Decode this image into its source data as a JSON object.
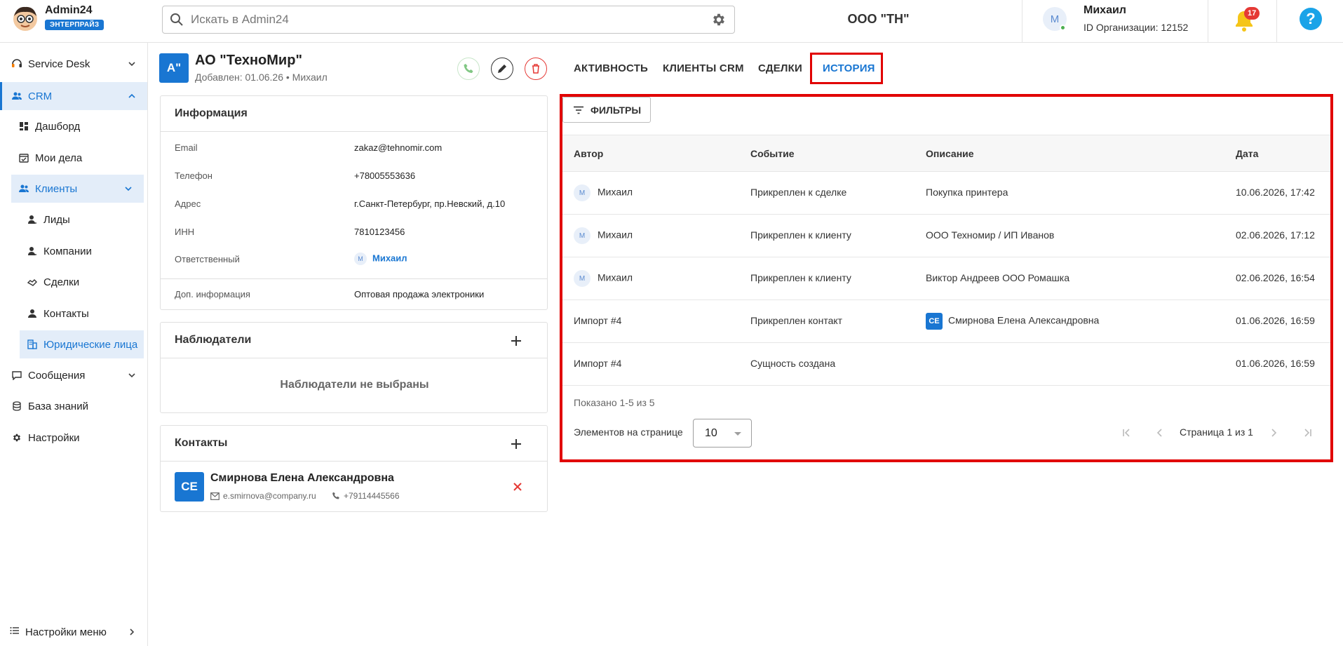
{
  "brand": {
    "name": "Admin24",
    "badge": "ЭНТЕРПРАЙЗ"
  },
  "search": {
    "placeholder": "Искать в Admin24"
  },
  "org": {
    "name": "ООО \"ТН\""
  },
  "user": {
    "avatar_letter": "М",
    "name": "Михаил",
    "org_id": "ID Организации: 12152"
  },
  "notifications": {
    "count": "17"
  },
  "help": {
    "label": "?"
  },
  "sidebar": {
    "items": [
      {
        "label": "Service Desk"
      },
      {
        "label": "CRM"
      },
      {
        "label": "Дашборд"
      },
      {
        "label": "Мои дела"
      },
      {
        "label": "Клиенты"
      },
      {
        "label": "Лиды"
      },
      {
        "label": "Компании"
      },
      {
        "label": "Сделки"
      },
      {
        "label": "Контакты"
      },
      {
        "label": "Юридические лица"
      },
      {
        "label": "Сообщения"
      },
      {
        "label": "База знаний"
      },
      {
        "label": "Настройки"
      }
    ],
    "footer": "Настройки меню"
  },
  "entity": {
    "avatar": "А\"",
    "title": "АО \"ТехноМир\"",
    "subtitle": "Добавлен: 01.06.26 • Михаил"
  },
  "info_card": {
    "title": "Информация",
    "rows": [
      {
        "key": "Email",
        "value": "zakaz@tehnomir.com"
      },
      {
        "key": "Телефон",
        "value": "+78005553636"
      },
      {
        "key": "Адрес",
        "value": "г.Санкт-Петербург, пр.Невский, д.10"
      },
      {
        "key": "ИНН",
        "value": "7810123456"
      },
      {
        "key": "Ответственный",
        "value": "Михаил",
        "avatar": "М"
      },
      {
        "key": "Доп. информация",
        "value": "Оптовая продажа электроники"
      }
    ]
  },
  "watchers_card": {
    "title": "Наблюдатели",
    "empty": "Наблюдатели не выбраны"
  },
  "contacts_card": {
    "title": "Контакты",
    "contact": {
      "initials": "СЕ",
      "name": "Смирнова Елена Александровна",
      "email": "e.smirnova@company.ru",
      "phone": "+79114445566"
    }
  },
  "tabs": [
    {
      "label": "АКТИВНОСТЬ"
    },
    {
      "label": "КЛИЕНТЫ CRM"
    },
    {
      "label": "СДЕЛКИ"
    },
    {
      "label": "ИСТОРИЯ"
    }
  ],
  "history": {
    "filter_label": "ФИЛЬТРЫ",
    "columns": [
      "Автор",
      "Событие",
      "Описание",
      "Дата"
    ],
    "rows": [
      {
        "author_avatar": "М",
        "author": "Михаил",
        "event": "Прикреплен к сделке",
        "desc_badge": "",
        "description": "Покупка принтера",
        "date": "10.06.2026, 17:42"
      },
      {
        "author_avatar": "М",
        "author": "Михаил",
        "event": "Прикреплен к клиенту",
        "desc_badge": "",
        "description": "ООО Техномир / ИП Иванов",
        "date": "02.06.2026, 17:12"
      },
      {
        "author_avatar": "М",
        "author": "Михаил",
        "event": "Прикреплен к клиенту",
        "desc_badge": "",
        "description": "Виктор Андреев ООО Ромашка",
        "date": "02.06.2026, 16:54"
      },
      {
        "author_avatar": "",
        "author": "Импорт #4",
        "event": "Прикреплен контакт",
        "desc_badge": "СЕ",
        "description": "Смирнова Елена Александровна",
        "date": "01.06.2026, 16:59"
      },
      {
        "author_avatar": "",
        "author": "Импорт #4",
        "event": "Сущность создана",
        "desc_badge": "",
        "description": "",
        "date": "01.06.2026, 16:59"
      }
    ],
    "shown": "Показано 1-5 из 5",
    "per_page_label": "Элементов на странице",
    "per_page_value": "10",
    "page_label": "Страница 1 из 1"
  },
  "colors": {
    "accent": "#1976d2",
    "highlight": "#e10000",
    "delete": "#e53935",
    "call": "#81c784"
  }
}
